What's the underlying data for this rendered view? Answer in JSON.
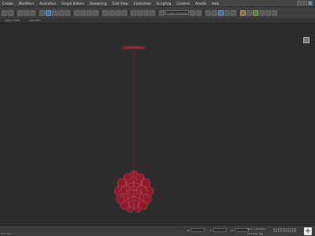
{
  "menu": [
    "Create",
    "Modifiers",
    "Animation",
    "Graph Editors",
    "Rendering",
    "Civil View",
    "Customize",
    "Scripting",
    "Content",
    "Arnold",
    "Help"
  ],
  "toolbar": {
    "selection_set_placeholder": "Create Selection Set"
  },
  "ribbon": {
    "tabs": [
      "Object Paint",
      "Populate"
    ]
  },
  "status": {
    "left_text": "Roll-dans",
    "coords": [
      {
        "label": "X:"
      },
      {
        "label": "Y:"
      },
      {
        "label": "Z:"
      }
    ],
    "grid": "Grid = 10.0mm",
    "add_time_tag": "Add Time Tag",
    "autokey_symbol": "+"
  },
  "colors": {
    "wireframe": "#8e1c2a",
    "viewport_bg": "#2d2d2d",
    "selected_tool": "#3f6f9f"
  }
}
